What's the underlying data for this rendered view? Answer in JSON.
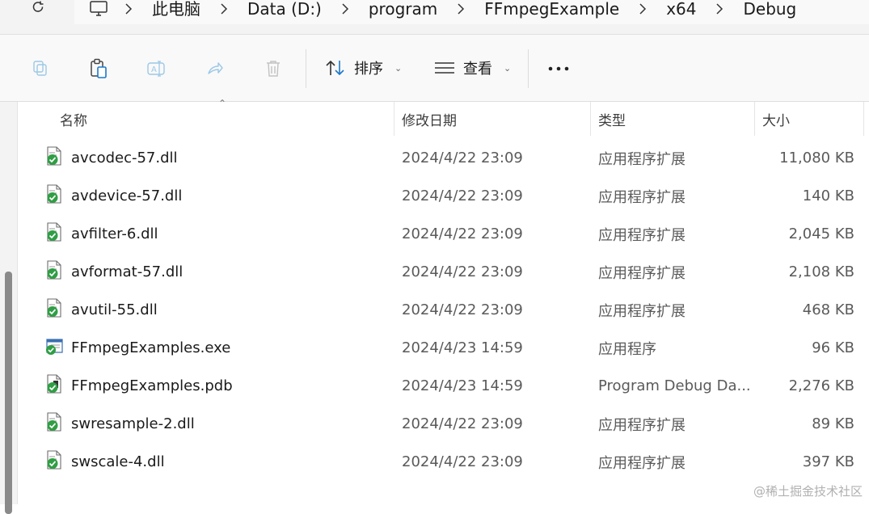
{
  "breadcrumb": {
    "items": [
      "此电脑",
      "Data (D:)",
      "program",
      "FFmpegExample",
      "x64",
      "Debug"
    ]
  },
  "toolbar": {
    "sort_label": "排序",
    "view_label": "查看"
  },
  "columns": {
    "name": "名称",
    "date": "修改日期",
    "type": "类型",
    "size": "大小"
  },
  "files": [
    {
      "name": "avcodec-57.dll",
      "date": "2024/4/22 23:09",
      "type": "应用程序扩展",
      "size": "11,080 KB",
      "icon": "dll-file-icon"
    },
    {
      "name": "avdevice-57.dll",
      "date": "2024/4/22 23:09",
      "type": "应用程序扩展",
      "size": "140 KB",
      "icon": "dll-file-icon"
    },
    {
      "name": "avfilter-6.dll",
      "date": "2024/4/22 23:09",
      "type": "应用程序扩展",
      "size": "2,045 KB",
      "icon": "dll-file-icon"
    },
    {
      "name": "avformat-57.dll",
      "date": "2024/4/22 23:09",
      "type": "应用程序扩展",
      "size": "2,108 KB",
      "icon": "dll-file-icon"
    },
    {
      "name": "avutil-55.dll",
      "date": "2024/4/22 23:09",
      "type": "应用程序扩展",
      "size": "468 KB",
      "icon": "dll-file-icon"
    },
    {
      "name": "FFmpegExamples.exe",
      "date": "2024/4/23 14:59",
      "type": "应用程序",
      "size": "96 KB",
      "icon": "exe-file-icon"
    },
    {
      "name": "FFmpegExamples.pdb",
      "date": "2024/4/23 14:59",
      "type": "Program Debug Da...",
      "size": "2,276 KB",
      "icon": "pdb-file-icon"
    },
    {
      "name": "swresample-2.dll",
      "date": "2024/4/22 23:09",
      "type": "应用程序扩展",
      "size": "89 KB",
      "icon": "dll-file-icon"
    },
    {
      "name": "swscale-4.dll",
      "date": "2024/4/22 23:09",
      "type": "应用程序扩展",
      "size": "397 KB",
      "icon": "dll-file-icon"
    }
  ],
  "watermark": "@稀土掘金技术社区"
}
